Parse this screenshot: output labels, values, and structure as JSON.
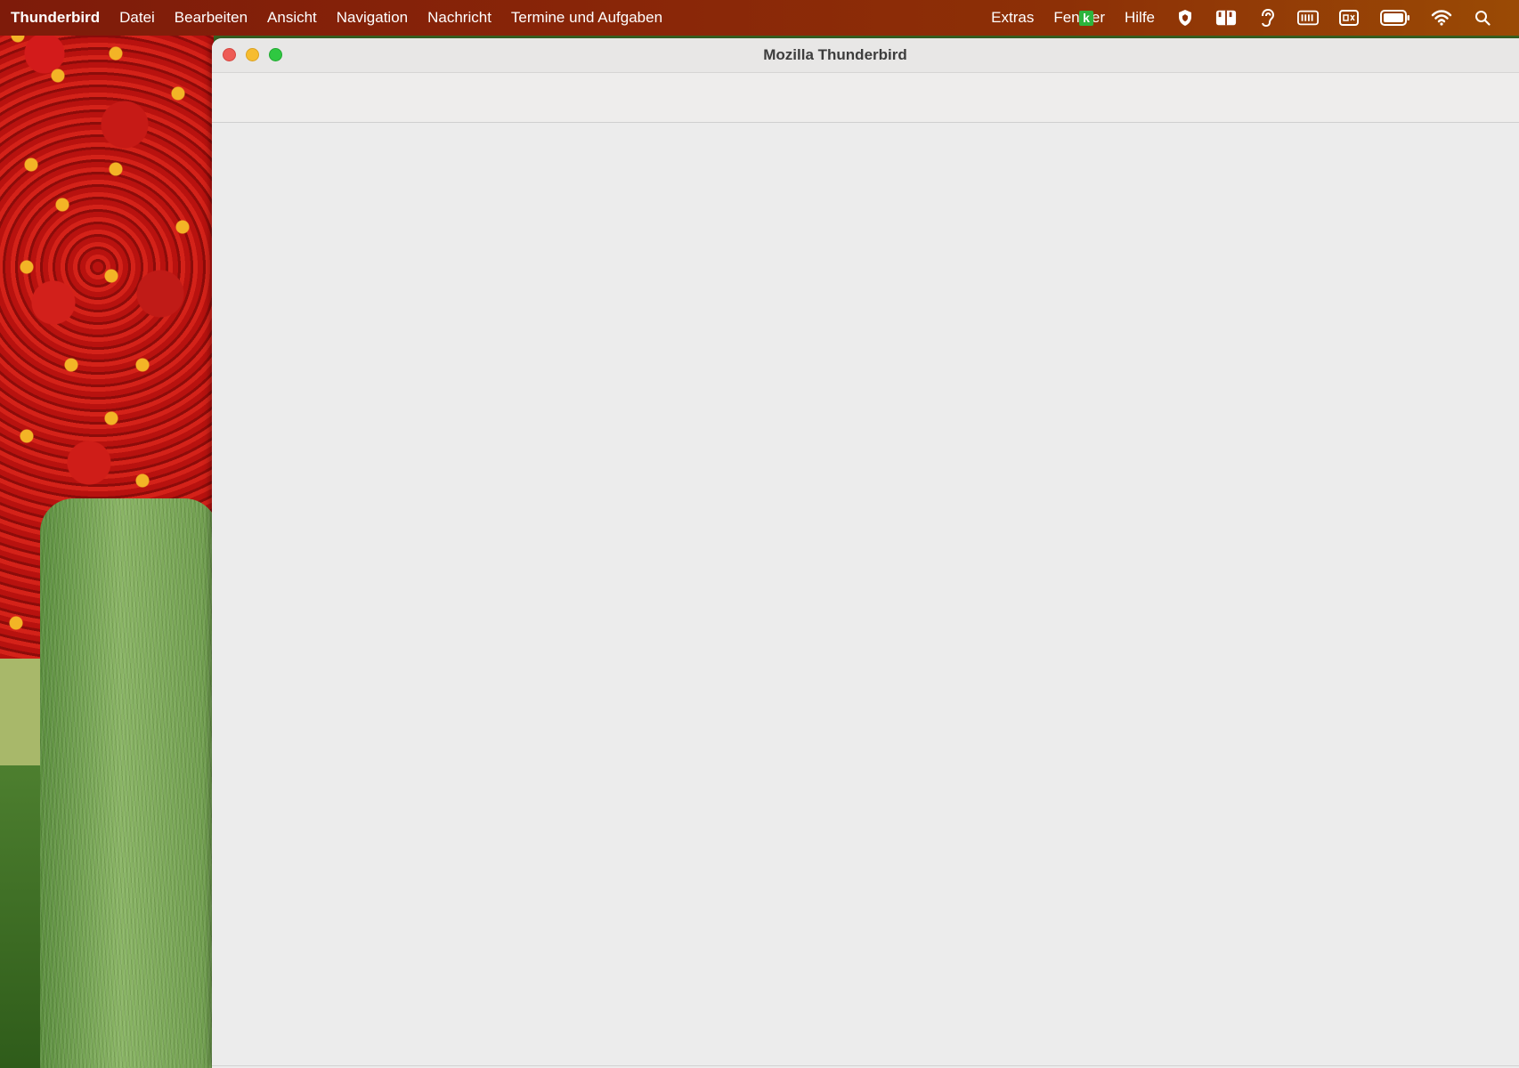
{
  "menubar": {
    "app_name": "Thunderbird",
    "items": [
      "Datei",
      "Bearbeiten",
      "Ansicht",
      "Navigation",
      "Nachricht",
      "Termine und Aufgaben",
      "Extras",
      "Fenster",
      "Hilfe"
    ],
    "keyboard_badge": "k",
    "status_icons": [
      "input-method-icon",
      "shield-icon",
      "reader-icon",
      "hearing-icon",
      "keyboard-icon",
      "caption-icon",
      "battery-icon",
      "wifi-icon",
      "search-icon"
    ]
  },
  "window": {
    "title": "Mozilla Thunderbird",
    "buttons": [
      "close",
      "minimize",
      "zoom"
    ]
  },
  "colors": {
    "menubar_start": "#7e1b0a",
    "menubar_end": "#9a4a05",
    "window_bg": "#ececec",
    "close": "#ee5b55",
    "minimize": "#f6bc2f",
    "zoom": "#2fc841"
  }
}
